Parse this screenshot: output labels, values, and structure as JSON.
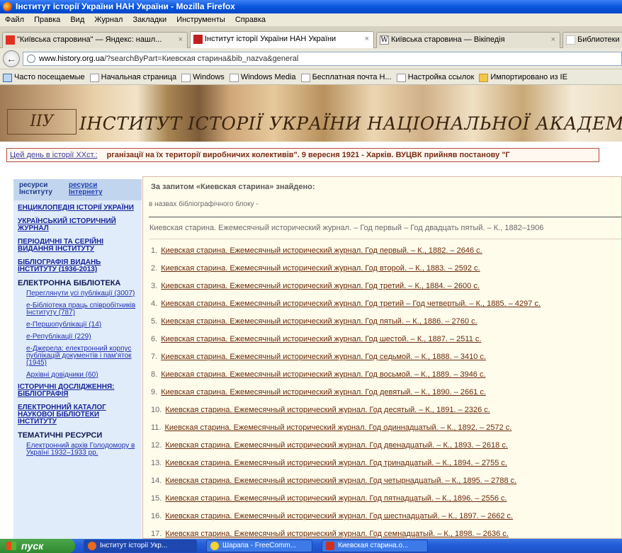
{
  "window": {
    "title": "Інститут історії України НАН України - Mozilla Firefox"
  },
  "menu": [
    "Файл",
    "Правка",
    "Вид",
    "Журнал",
    "Закладки",
    "Инструменты",
    "Справка"
  ],
  "tabs": [
    {
      "label": "\"Київська старовина\" — Яндекс: нашл...",
      "close": "×",
      "icon_color": "#e03020"
    },
    {
      "label": "Інститут історії України НАН України",
      "close": "×",
      "icon_color": "#c02020"
    },
    {
      "label": "Київська старовина — Вікіпедія",
      "close": "×",
      "icon_color": "#ffffff"
    },
    {
      "label": "Библиотеки",
      "close": "",
      "icon_color": "#ffffff"
    }
  ],
  "nav": {
    "back": "←",
    "url_host": "www.history.org.ua",
    "url_rest": "/?searchByPart=Киевская старина&bib_nazva&general"
  },
  "bookmarks": [
    "Часто посещаемые",
    "Начальная страница",
    "Windows",
    "Windows Media",
    "Бесплатная почта H...",
    "Настройка ссылок",
    "Импортировано из IE"
  ],
  "banner": {
    "logo_text": "ІІУ",
    "title": "ІНСТИТУТ ІСТОРІЇ УКРАЇНИ НАЦІОНАЛЬНОЇ АКАДЕМІЇ НАУК УКРАЇНИ"
  },
  "ticker": {
    "label": "Цей день в історії ХХст.:",
    "text": "рганізації на їх території виробничих колективів\".        9 вересня   1921  -  Харків. ВУЦВК прийняв постанову \"Г"
  },
  "sidebar": {
    "tab1": "ресурси Інституту",
    "tab2": "ресурси Інтернету",
    "items": [
      {
        "type": "link",
        "label": "ЕНЦИКЛОПЕДІЯ ІСТОРІЇ УКРАЇНИ"
      },
      {
        "type": "link",
        "label": "УКРАЇНСЬКИЙ ІСТОРИЧНИЙ ЖУРНАЛ"
      },
      {
        "type": "link",
        "label": "ПЕРІОДИЧНІ ТА СЕРІЙНІ ВИДАННЯ ІНСТИТУТУ"
      },
      {
        "type": "link",
        "label": "БІБЛІОГРАФІЯ ВИДАНЬ ІНСТИТУТУ (1936-2013)"
      },
      {
        "type": "head",
        "label": "ЕЛЕКТРОННА БІБЛІОТЕКА"
      },
      {
        "type": "sub",
        "label": "Переглянути усі публікації (3007)"
      },
      {
        "type": "sub",
        "label": "е-Бібліотека праць співробітників Інституту (787)"
      },
      {
        "type": "sub",
        "label": "е-Першопублікації (14)"
      },
      {
        "type": "sub",
        "label": "е-Републікації (229)"
      },
      {
        "type": "sub",
        "label": "е-Джерела: електронний корпус публікацій документів і пам'яток (1945)"
      },
      {
        "type": "sub",
        "label": "Архівні довідники (60)"
      },
      {
        "type": "link",
        "label": "ІСТОРИЧНІ ДОСЛІДЖЕННЯ: БІБЛІОГРАФІЯ"
      },
      {
        "type": "link",
        "label": "ЕЛЕКТРОННИЙ КАТАЛОГ НАУКОВОЇ БІБЛІОТЕКИ ІНСТИТУТУ"
      },
      {
        "type": "head",
        "label": "ТЕМАТИЧНІ РЕСУРСИ"
      },
      {
        "type": "sub",
        "label": "Електронний архів Голодомору в Україні 1932–1933 рр."
      }
    ]
  },
  "main": {
    "query": "За запитом «Киевская старина» знайдено:",
    "query_sub": "в назвах бібліографічного блоку -",
    "summary": "Киевская старина. Ежемесячный исторический журнал. – Год первый – Год двадцать пятый. – К., 1882–1906",
    "results": [
      {
        "n": "1.",
        "t": "Киевская старина. Ежемесячный исторический журнал. Год первый. – К., 1882. – 2646 с."
      },
      {
        "n": "2.",
        "t": "Киевская старина. Ежемесячный исторический журнал. Год второй. – К., 1883. – 2592 с."
      },
      {
        "n": "3.",
        "t": "Киевская старина. Ежемесячный исторический журнал. Год третий. – К., 1884. – 2600 с."
      },
      {
        "n": "4.",
        "t": "Киевская старина. Ежемесячный исторический журнал. Год третий – Год четвертый. – К., 1885. – 4297 с."
      },
      {
        "n": "5.",
        "t": "Киевская старина. Ежемесячный исторический журнал. Год пятый. – К., 1886. – 2760 с."
      },
      {
        "n": "6.",
        "t": "Киевская старина. Ежемесячный исторический журнал. Год шестой. – К., 1887. – 2511 с."
      },
      {
        "n": "7.",
        "t": "Киевская старина. Ежемесячный исторический журнал. Год седьмой. – К., 1888. – 3410 с."
      },
      {
        "n": "8.",
        "t": "Киевская старина. Ежемесячный исторический журнал. Год восьмой. – К., 1889. – 3946 с."
      },
      {
        "n": "9.",
        "t": "Киевская старина. Ежемесячный исторический журнал. Год девятый. – К., 1890. – 2661 с."
      },
      {
        "n": "10.",
        "t": "Киевская старина. Ежемесячный исторический журнал. Год десятый. – К., 1891. – 2326 с."
      },
      {
        "n": "11.",
        "t": "Киевская старина. Ежемесячный исторический журнал. Год одиннадцатый. – К., 1892. – 2572 с."
      },
      {
        "n": "12.",
        "t": "Киевская старина. Ежемесячный исторический журнал. Год двенадцатый. – К., 1893. – 2618 с."
      },
      {
        "n": "13.",
        "t": "Киевская старина. Ежемесячный исторический журнал. Год тринадцатый. – К., 1894. – 2755 с."
      },
      {
        "n": "14.",
        "t": "Киевская старина. Ежемесячный исторический журнал. Год четырнадцатый. – К., 1895. – 2788 с."
      },
      {
        "n": "15.",
        "t": "Киевская старина. Ежемесячный исторический журнал. Год пятнадцатый. – К., 1896. – 2556 с."
      },
      {
        "n": "16.",
        "t": "Киевская старина. Ежемесячный исторический журнал. Год шестнадцатый. – К., 1897. – 2662 с."
      },
      {
        "n": "17.",
        "t": "Киевская старина. Ежемесячный исторический журнал. Год семнадцатый. – К., 1898. – 2636 с."
      }
    ]
  },
  "taskbar": {
    "start": "пуск",
    "tasks": [
      {
        "label": "Інститут історії Укр...",
        "icon_color": "#e86a1a"
      },
      {
        "label": "Шарапа - FreeComm...",
        "icon_color": "#f4d030"
      },
      {
        "label": "Киевская старина.о...",
        "icon_color": "#d03020"
      }
    ]
  }
}
